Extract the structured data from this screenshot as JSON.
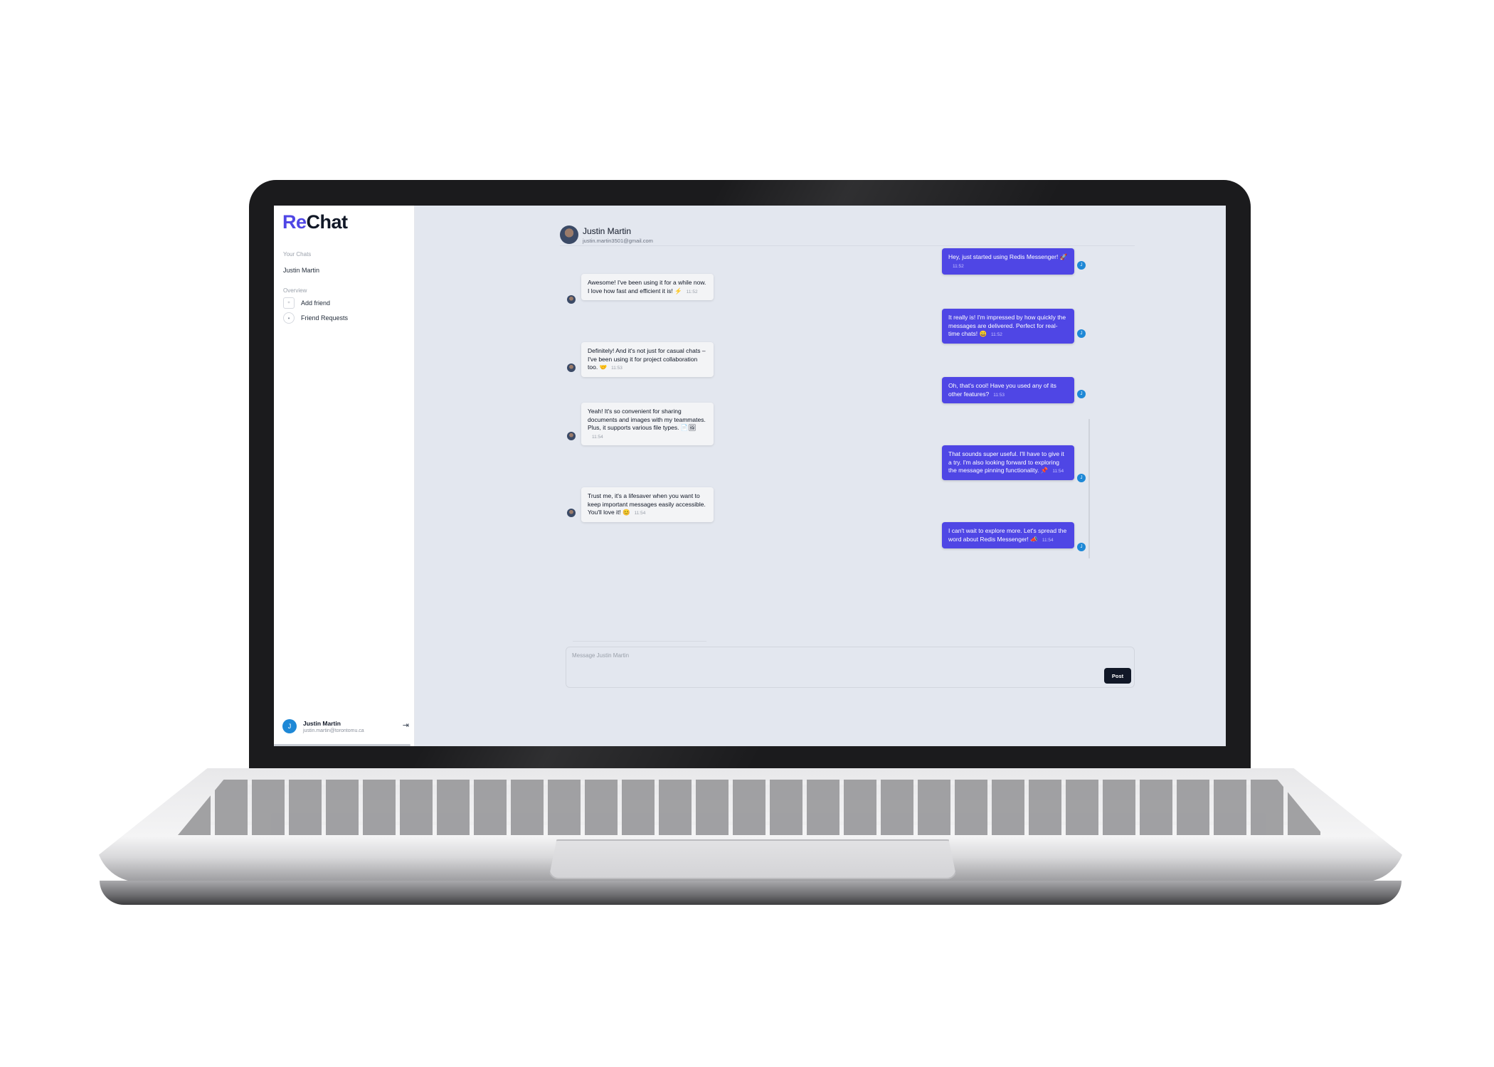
{
  "app": {
    "logo_prefix": "Re",
    "logo_suffix": "Chat"
  },
  "sidebar": {
    "your_chats_label": "Your Chats",
    "chats": [
      {
        "name": "Justin Martin"
      }
    ],
    "overview_label": "Overview",
    "nav": [
      {
        "label": "Add friend",
        "icon": "user-plus-icon"
      },
      {
        "label": "Friend Requests",
        "icon": "user-icon"
      }
    ],
    "user": {
      "initial": "J",
      "name": "Justin Martin",
      "email": "justin.martin@torontomu.ca",
      "logout_icon": "logout-icon"
    }
  },
  "chat": {
    "partner_name": "Justin Martin",
    "partner_email": "justin.martin3501@gmail.com",
    "my_initial": "J",
    "messages": [
      {
        "dir": "out",
        "text": "Hey, just started using Redis Messenger! 🚀",
        "time": "11:52"
      },
      {
        "dir": "in",
        "text": "Awesome! I've been using it for a while now. I love how fast and efficient it is! ⚡",
        "time": "11:52"
      },
      {
        "dir": "out",
        "text": "It really is! I'm impressed by how quickly the messages are delivered. Perfect for real-time chats! 😀",
        "time": "11:52"
      },
      {
        "dir": "in",
        "text": "Definitely! And it's not just for casual chats – I've been using it for project collaboration too. 🤝",
        "time": "11:53"
      },
      {
        "dir": "out",
        "text": "Oh, that's cool! Have you used any of its other features?",
        "time": "11:53"
      },
      {
        "dir": "in",
        "text": "Yeah! It's so convenient for sharing documents and images with my teammates. Plus, it supports various file types. 📄🖼",
        "time": "11:54"
      },
      {
        "dir": "out",
        "text": "That sounds super useful. I'll have to give it a try. I'm also looking forward to exploring the message pinning functionality. 📌",
        "time": "11:54"
      },
      {
        "dir": "in",
        "text": "Trust me, it's a lifesaver when you want to keep important messages easily accessible. You'll love it! 😊",
        "time": "11:54"
      },
      {
        "dir": "out",
        "text": "I can't wait to explore more. Let's spread the word about Redis Messenger! 📣",
        "time": "11:54"
      }
    ],
    "compose": {
      "placeholder": "Message Justin Martin",
      "value": "",
      "send_label": "Post"
    }
  },
  "colors": {
    "accent": "#4f46e5",
    "avatar_blue": "#1e88d6",
    "chat_bg": "#e3e7ef",
    "button_dark": "#111827"
  }
}
